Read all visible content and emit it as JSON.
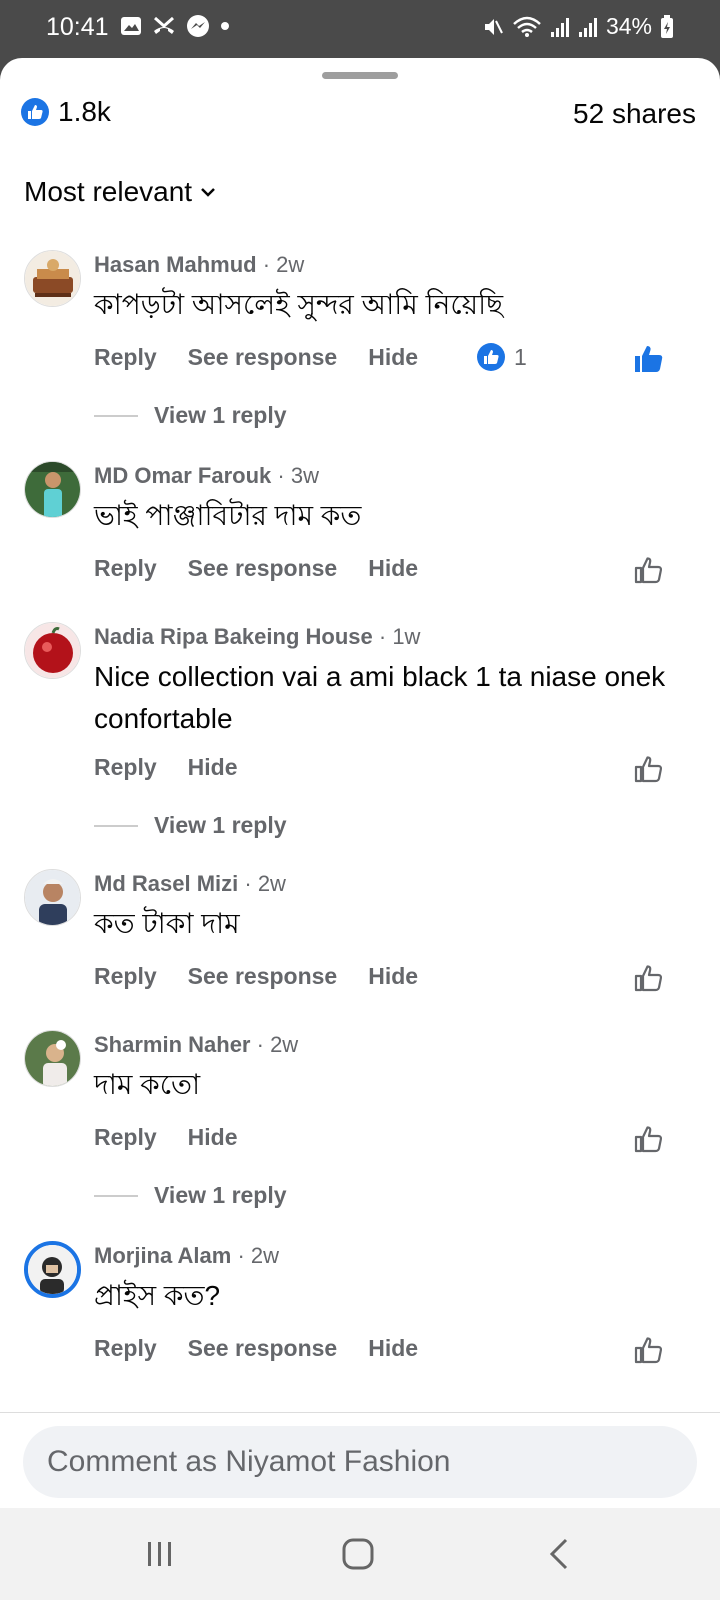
{
  "status_bar": {
    "time": "10:41",
    "battery": "34%",
    "left_icons": [
      "gallery-icon",
      "missed-call-icon",
      "messenger-icon",
      "dot-icon"
    ],
    "right_icons": [
      "mute-icon",
      "wifi-icon",
      "signal-icon",
      "signal-icon",
      "battery-icon"
    ]
  },
  "header": {
    "reaction_count": "1.8k",
    "shares": "52 shares",
    "sort_label": "Most relevant"
  },
  "action_labels": {
    "reply": "Reply",
    "see_response": "See response",
    "hide": "Hide",
    "view_reply": "View 1 reply"
  },
  "comments": [
    {
      "name": "Hasan Mahmud",
      "time": "· 2w",
      "text": "কাপড়টা আসলেই সুন্দর আমি নিয়েছি",
      "reaction_count": "1"
    },
    {
      "name": "MD Omar Farouk",
      "time": "· 3w",
      "text": "ভাই পাঞ্জাবিটার দাম কত"
    },
    {
      "name": "Nadia Ripa Bakeing House",
      "time": "· 1w",
      "text": "Nice collection  vai a ami  black 1 ta niase onek confortable"
    },
    {
      "name": "Md Rasel Mizi",
      "time": "· 2w",
      "text": "কত টাকা দাম"
    },
    {
      "name": "Sharmin Naher",
      "time": "· 2w",
      "text": "দাম কতো"
    },
    {
      "name": "Morjina Alam",
      "time": "· 2w",
      "text": "প্রাইস কত?"
    }
  ],
  "composer": {
    "placeholder": "Comment as Niyamot Fashion"
  },
  "colors": {
    "accent": "#1b74e4",
    "secondary_text": "#65676b",
    "primary_text": "#050505",
    "status_bar_bg": "#4a4a4a"
  }
}
